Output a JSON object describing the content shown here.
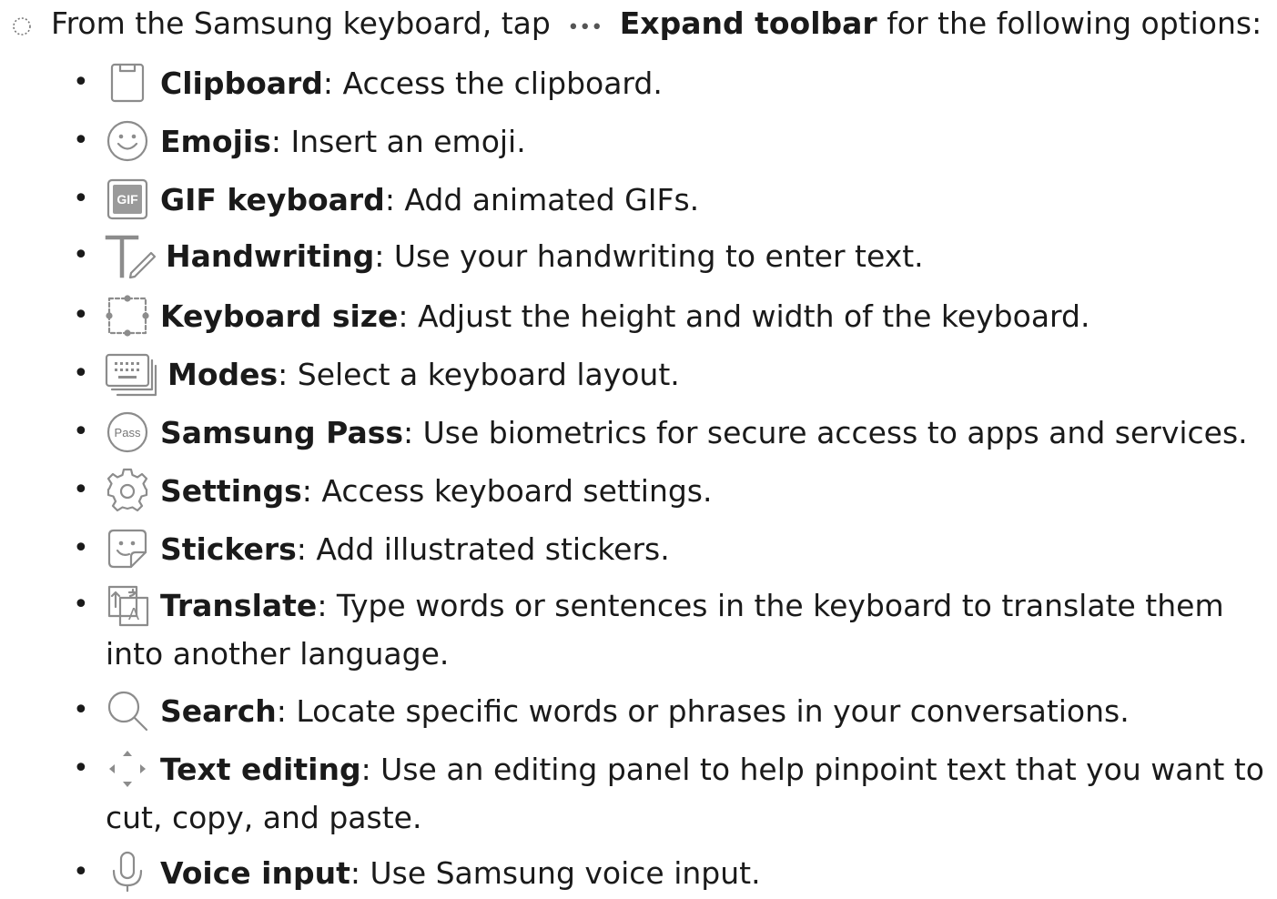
{
  "intro": {
    "text_before": "From the Samsung keyboard, tap",
    "dots": "•••",
    "bold": "Expand toolbar",
    "text_after": "for the following options:",
    "marker_icon": "list-marker-icon"
  },
  "items": [
    {
      "icon": "clipboard-icon",
      "title": "Clipboard",
      "desc": ": Access the clipboard."
    },
    {
      "icon": "emoji-icon",
      "title": "Emojis",
      "desc": ": Insert an emoji."
    },
    {
      "icon": "gif-icon",
      "title": "GIF keyboard",
      "desc": ": Add animated GIFs."
    },
    {
      "icon": "handwriting-icon",
      "title": "Handwriting",
      "desc": ": Use your handwriting to enter text."
    },
    {
      "icon": "keyboard-size-icon",
      "title": "Keyboard size",
      "desc": ": Adjust the height and width of the keyboard."
    },
    {
      "icon": "modes-icon",
      "title": "Modes",
      "desc": ": Select a keyboard layout."
    },
    {
      "icon": "samsung-pass-icon",
      "title": "Samsung Pass",
      "desc": ": Use biometrics for secure access to apps and services.",
      "icon_text": "Pass"
    },
    {
      "icon": "settings-icon",
      "title": "Settings",
      "desc": ": Access keyboard settings."
    },
    {
      "icon": "stickers-icon",
      "title": "Stickers",
      "desc": ": Add illustrated stickers."
    },
    {
      "icon": "translate-icon",
      "title": "Translate",
      "desc": ": Type words or sentences in the keyboard to translate them",
      "desc_cont": "into another language.",
      "icon_text": "A"
    },
    {
      "icon": "search-icon",
      "title": "Search",
      "desc": ": Locate specific words or phrases in your conversations."
    },
    {
      "icon": "text-editing-icon",
      "title": "Text editing",
      "desc": ": Use an editing panel to help pinpoint text that you want to",
      "desc_cont": "cut, copy, and paste."
    },
    {
      "icon": "voice-input-icon",
      "title": "Voice input",
      "desc": ": Use Samsung voice input."
    }
  ],
  "bullet": "•",
  "gif_label": "GIF"
}
